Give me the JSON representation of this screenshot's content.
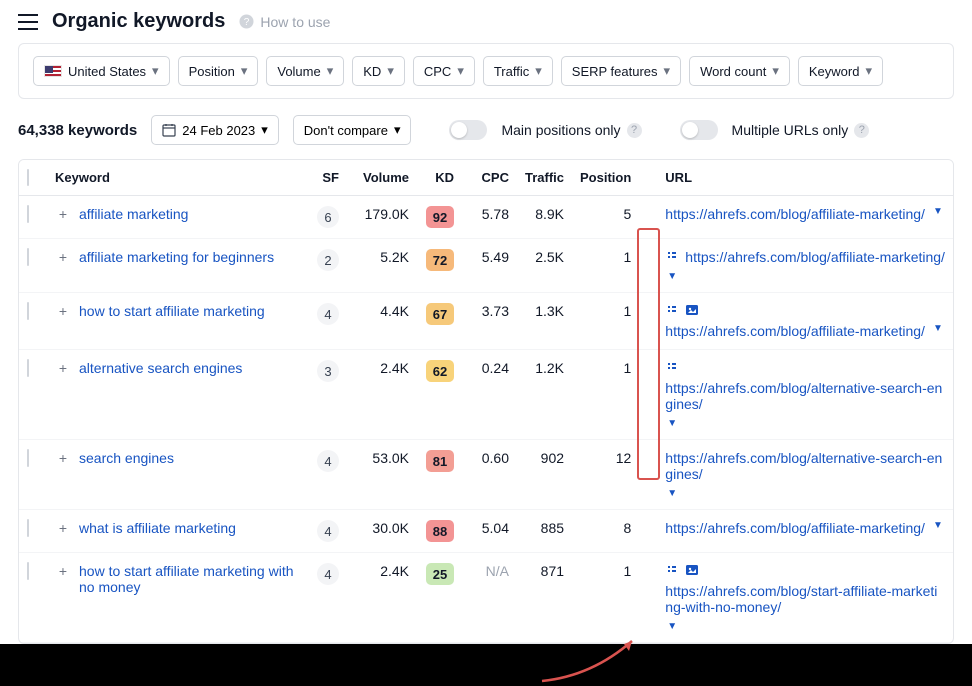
{
  "header": {
    "title": "Organic keywords",
    "how_to": "How to use"
  },
  "filters": [
    {
      "label": "United States",
      "flag": true
    },
    {
      "label": "Position"
    },
    {
      "label": "Volume"
    },
    {
      "label": "KD"
    },
    {
      "label": "CPC"
    },
    {
      "label": "Traffic"
    },
    {
      "label": "SERP features"
    },
    {
      "label": "Word count"
    },
    {
      "label": "Keyword"
    }
  ],
  "controls": {
    "count": "64,338 keywords",
    "date": "24 Feb 2023",
    "compare": "Don't compare",
    "toggle1": "Main positions only",
    "toggle2": "Multiple URLs only"
  },
  "columns": {
    "keyword": "Keyword",
    "sf": "SF",
    "volume": "Volume",
    "kd": "KD",
    "cpc": "CPC",
    "traffic": "Traffic",
    "position": "Position",
    "url": "URL"
  },
  "rows": [
    {
      "keyword": "affiliate marketing",
      "sf": "6",
      "volume": "179.0K",
      "kd": "92",
      "kd_color": "#f39494",
      "cpc": "5.78",
      "traffic": "8.9K",
      "position": "5",
      "serp_icons": [],
      "url": "https://ahrefs.com/blog/affiliate-marketing/"
    },
    {
      "keyword": "affiliate marketing for beginners",
      "sf": "2",
      "volume": "5.2K",
      "kd": "72",
      "kd_color": "#f6b97a",
      "cpc": "5.49",
      "traffic": "2.5K",
      "position": "1",
      "serp_icons": [
        "sitelinks"
      ],
      "url": "https://ahrefs.com/blog/affiliate-marketing/"
    },
    {
      "keyword": "how to start affiliate marketing",
      "sf": "4",
      "volume": "4.4K",
      "kd": "67",
      "kd_color": "#f6c97a",
      "cpc": "3.73",
      "traffic": "1.3K",
      "position": "1",
      "serp_icons": [
        "sitelinks",
        "image"
      ],
      "url": "https://ahrefs.com/blog/affiliate-marketing/"
    },
    {
      "keyword": "alternative search engines",
      "sf": "3",
      "volume": "2.4K",
      "kd": "62",
      "kd_color": "#f8d37a",
      "cpc": "0.24",
      "traffic": "1.2K",
      "position": "1",
      "serp_icons": [
        "sitelinks"
      ],
      "url": "https://ahrefs.com/blog/alternative-search-engines/"
    },
    {
      "keyword": "search engines",
      "sf": "4",
      "volume": "53.0K",
      "kd": "81",
      "kd_color": "#f39e94",
      "cpc": "0.60",
      "traffic": "902",
      "position": "12",
      "serp_icons": [],
      "url": "https://ahrefs.com/blog/alternative-search-engines/"
    },
    {
      "keyword": "what is affiliate marketing",
      "sf": "4",
      "volume": "30.0K",
      "kd": "88",
      "kd_color": "#f39494",
      "cpc": "5.04",
      "traffic": "885",
      "position": "8",
      "serp_icons": [],
      "url": "https://ahrefs.com/blog/affiliate-marketing/"
    },
    {
      "keyword": "how to start affiliate marketing with no money",
      "sf": "4",
      "volume": "2.4K",
      "kd": "25",
      "kd_color": "#c9e8b5",
      "cpc": "N/A",
      "traffic": "871",
      "position": "1",
      "serp_icons": [
        "sitelinks",
        "image"
      ],
      "url": "https://ahrefs.com/blog/start-affiliate-marketing-with-no-money/"
    }
  ]
}
